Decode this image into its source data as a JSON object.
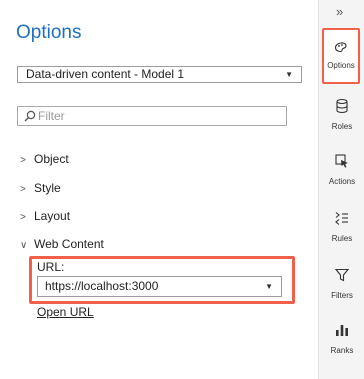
{
  "header": {
    "title": "Options"
  },
  "model_select": {
    "value": "Data-driven content - Model 1"
  },
  "filter": {
    "placeholder": "Filter"
  },
  "sections": [
    {
      "label": "Object",
      "expanded": false
    },
    {
      "label": "Style",
      "expanded": false
    },
    {
      "label": "Layout",
      "expanded": false
    },
    {
      "label": "Web Content",
      "expanded": true
    }
  ],
  "web_content": {
    "url_label": "URL:",
    "url_value": "https://localhost:3000",
    "open_url": "Open URL"
  },
  "rail": {
    "collapse": "»",
    "items": [
      {
        "label": "Options",
        "icon": "paint-options-icon",
        "active": true
      },
      {
        "label": "Roles",
        "icon": "database-icon"
      },
      {
        "label": "Actions",
        "icon": "cursor-icon"
      },
      {
        "label": "Rules",
        "icon": "rules-icon"
      },
      {
        "label": "Filters",
        "icon": "funnel-icon"
      },
      {
        "label": "Ranks",
        "icon": "bar-chart-icon"
      }
    ]
  },
  "colors": {
    "accent": "#1f6fbf",
    "highlight": "#f0604a"
  }
}
